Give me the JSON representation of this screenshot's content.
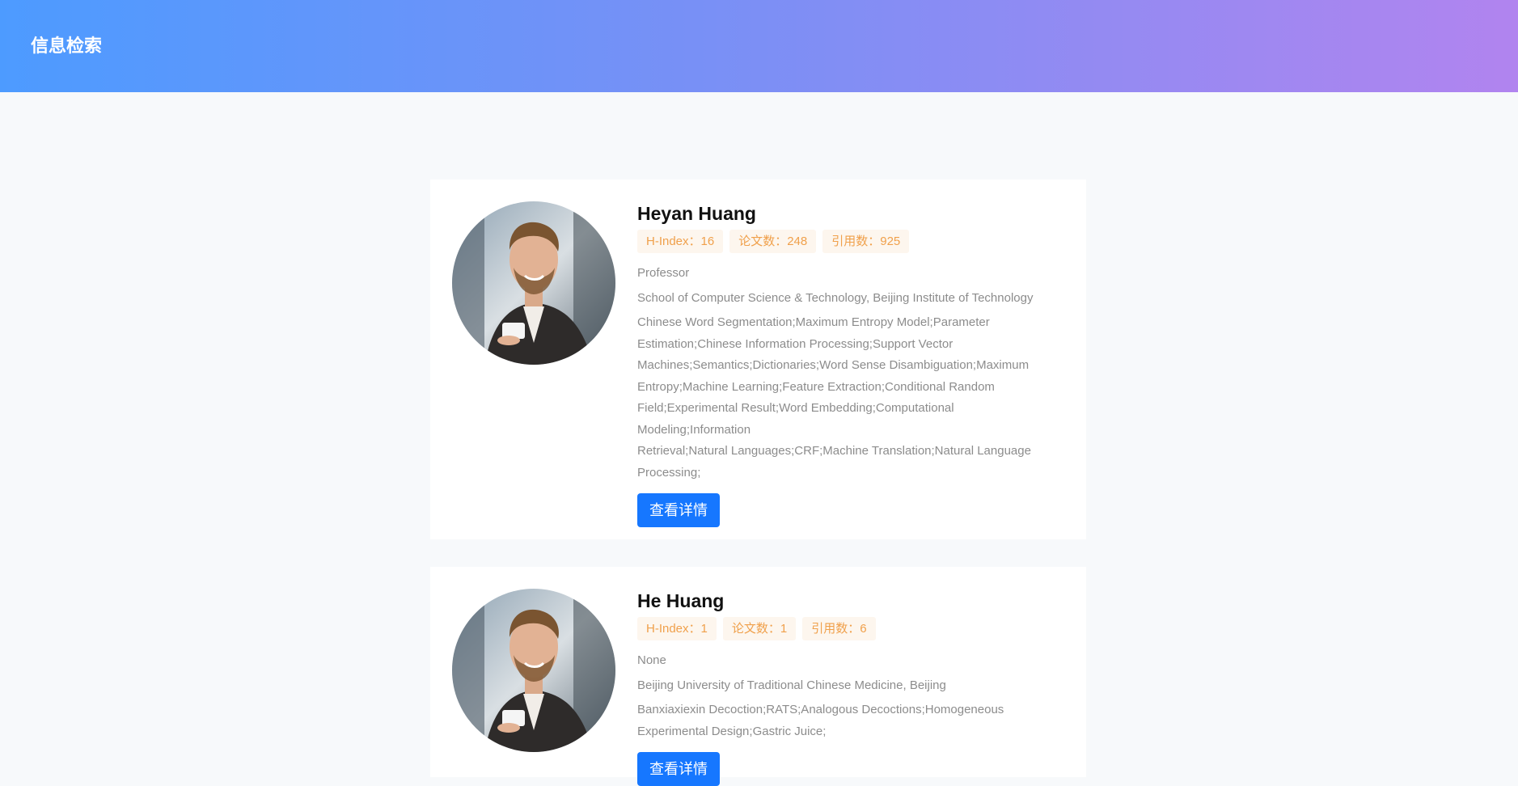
{
  "artifact": {
    "text": "\">"
  },
  "header": {
    "title": "信息检索"
  },
  "colors": {
    "accent": "#1677ff",
    "tag_text": "#f0a04b",
    "tag_bg": "#fdf6ee",
    "header_start": "#4d9bff",
    "header_end": "#b184ef"
  },
  "results": [
    {
      "name": "Heyan Huang",
      "stats": {
        "h_index": "H-Index：16",
        "papers": "论文数：248",
        "citations": "引用数：925"
      },
      "position": "Professor",
      "affiliation": "School of Computer Science & Technology, Beijing Institute of Technology",
      "interests": [
        "Chinese Word Segmentation;Maximum Entropy Model;Parameter",
        "Estimation;Chinese Information Processing;Support Vector",
        "Machines;Semantics;Dictionaries;Word Sense Disambiguation;Maximum",
        "Entropy;Machine Learning;Feature Extraction;Conditional Random",
        "Field;Experimental Result;Word Embedding;Computational Modeling;Information",
        "Retrieval;Natural Languages;CRF;Machine Translation;Natural Language",
        "Processing;"
      ],
      "button_label": "查看详情",
      "avatar_icon": "person-with-coffee-photo"
    },
    {
      "name": "He Huang",
      "stats": {
        "h_index": "H-Index：1",
        "papers": "论文数：1",
        "citations": "引用数：6"
      },
      "position": "None",
      "affiliation": "Beijing University of Traditional Chinese Medicine, Beijing",
      "interests": [
        "Banxiaxiexin Decoction;RATS;Analogous Decoctions;Homogeneous",
        "Experimental Design;Gastric Juice;"
      ],
      "button_label": "查看详情",
      "avatar_icon": "person-with-coffee-photo"
    }
  ]
}
